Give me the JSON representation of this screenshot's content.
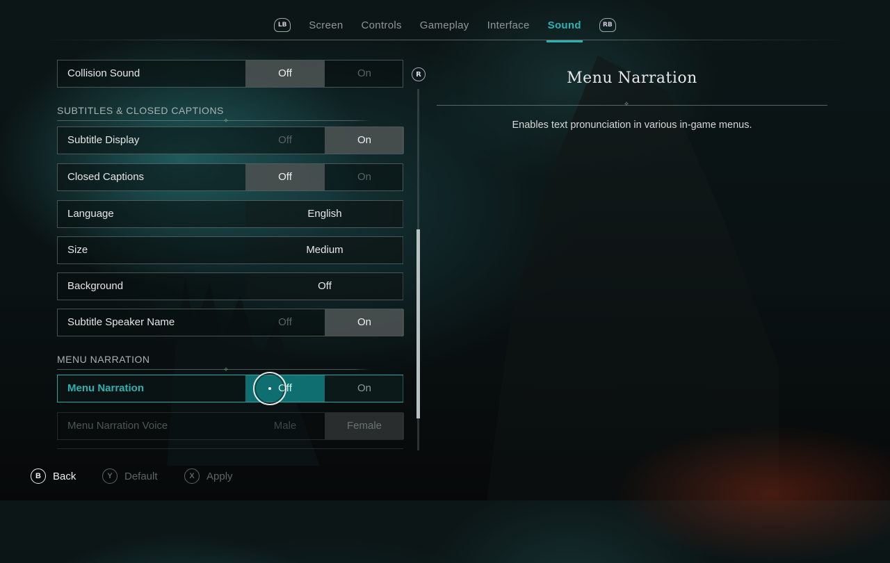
{
  "tabs": {
    "left_bumper": "LB",
    "right_bumper": "RB",
    "items": [
      {
        "label": "Screen",
        "active": false
      },
      {
        "label": "Controls",
        "active": false
      },
      {
        "label": "Gameplay",
        "active": false
      },
      {
        "label": "Interface",
        "active": false
      },
      {
        "label": "Sound",
        "active": true
      }
    ]
  },
  "settings": {
    "collision_sound": {
      "label": "Collision Sound",
      "options": [
        "Off",
        "On"
      ],
      "selected": "Off"
    },
    "subtitles_section": "SUBTITLES & CLOSED CAPTIONS",
    "subtitle_display": {
      "label": "Subtitle Display",
      "options": [
        "Off",
        "On"
      ],
      "selected": "On"
    },
    "closed_captions": {
      "label": "Closed Captions",
      "options": [
        "Off",
        "On"
      ],
      "selected": "Off"
    },
    "language": {
      "label": "Language",
      "value": "English"
    },
    "size": {
      "label": "Size",
      "value": "Medium"
    },
    "background": {
      "label": "Background",
      "value": "Off"
    },
    "subtitle_speaker_name": {
      "label": "Subtitle Speaker Name",
      "options": [
        "Off",
        "On"
      ],
      "selected": "On"
    },
    "menu_narration_section": "MENU NARRATION",
    "menu_narration": {
      "label": "Menu Narration",
      "options": [
        "Off",
        "On"
      ],
      "selected": "Off"
    },
    "menu_narration_voice": {
      "label": "Menu Narration Voice",
      "options": [
        "Male",
        "Female"
      ],
      "selected": "Female"
    }
  },
  "scroll_indicator": "R",
  "description": {
    "title": "Menu Narration",
    "text": "Enables text pronunciation in various in-game menus."
  },
  "footer": {
    "back": {
      "button": "B",
      "label": "Back"
    },
    "default": {
      "button": "Y",
      "label": "Default"
    },
    "apply": {
      "button": "X",
      "label": "Apply"
    }
  },
  "colors": {
    "accent": "#2bb3b3",
    "focused_option": "#0f6f70",
    "selected_option": "#505656"
  }
}
